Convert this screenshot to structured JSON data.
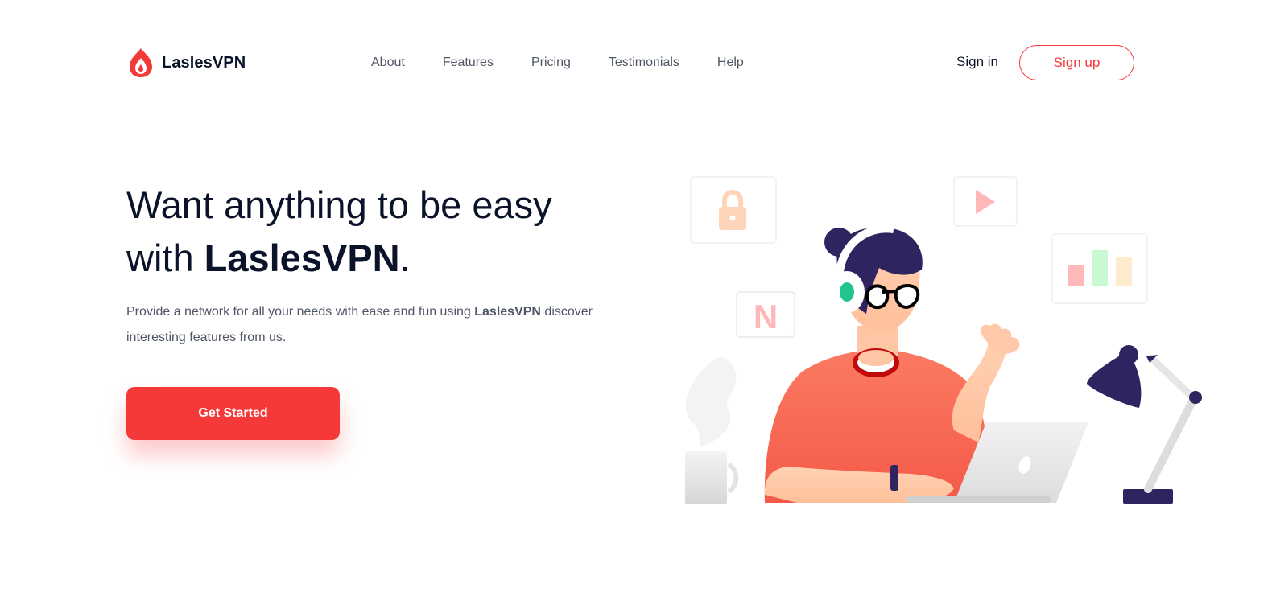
{
  "brand": {
    "name": "LaslesVPN",
    "accent": "#f53838",
    "text_color": "#0b132a"
  },
  "nav": {
    "items": [
      {
        "label": "About"
      },
      {
        "label": "Features"
      },
      {
        "label": "Pricing"
      },
      {
        "label": "Testimonials"
      },
      {
        "label": "Help"
      }
    ]
  },
  "auth": {
    "signin_label": "Sign in",
    "signup_label": "Sign up"
  },
  "hero": {
    "title_line1": "Want anything to be easy",
    "title_line2_prefix": "with ",
    "title_brand": "LaslesVPN",
    "title_suffix": ".",
    "desc_prefix": "Provide a network for all your needs with ease and fun using ",
    "desc_brand": "LaslesVPN",
    "desc_suffix": " discover interesting features from us.",
    "cta_label": "Get Started"
  },
  "illustration": {
    "floating_icons": [
      "lock-icon",
      "play-icon",
      "netflix-icon",
      "bar-chart-icon"
    ],
    "netflix_letter": "N"
  }
}
